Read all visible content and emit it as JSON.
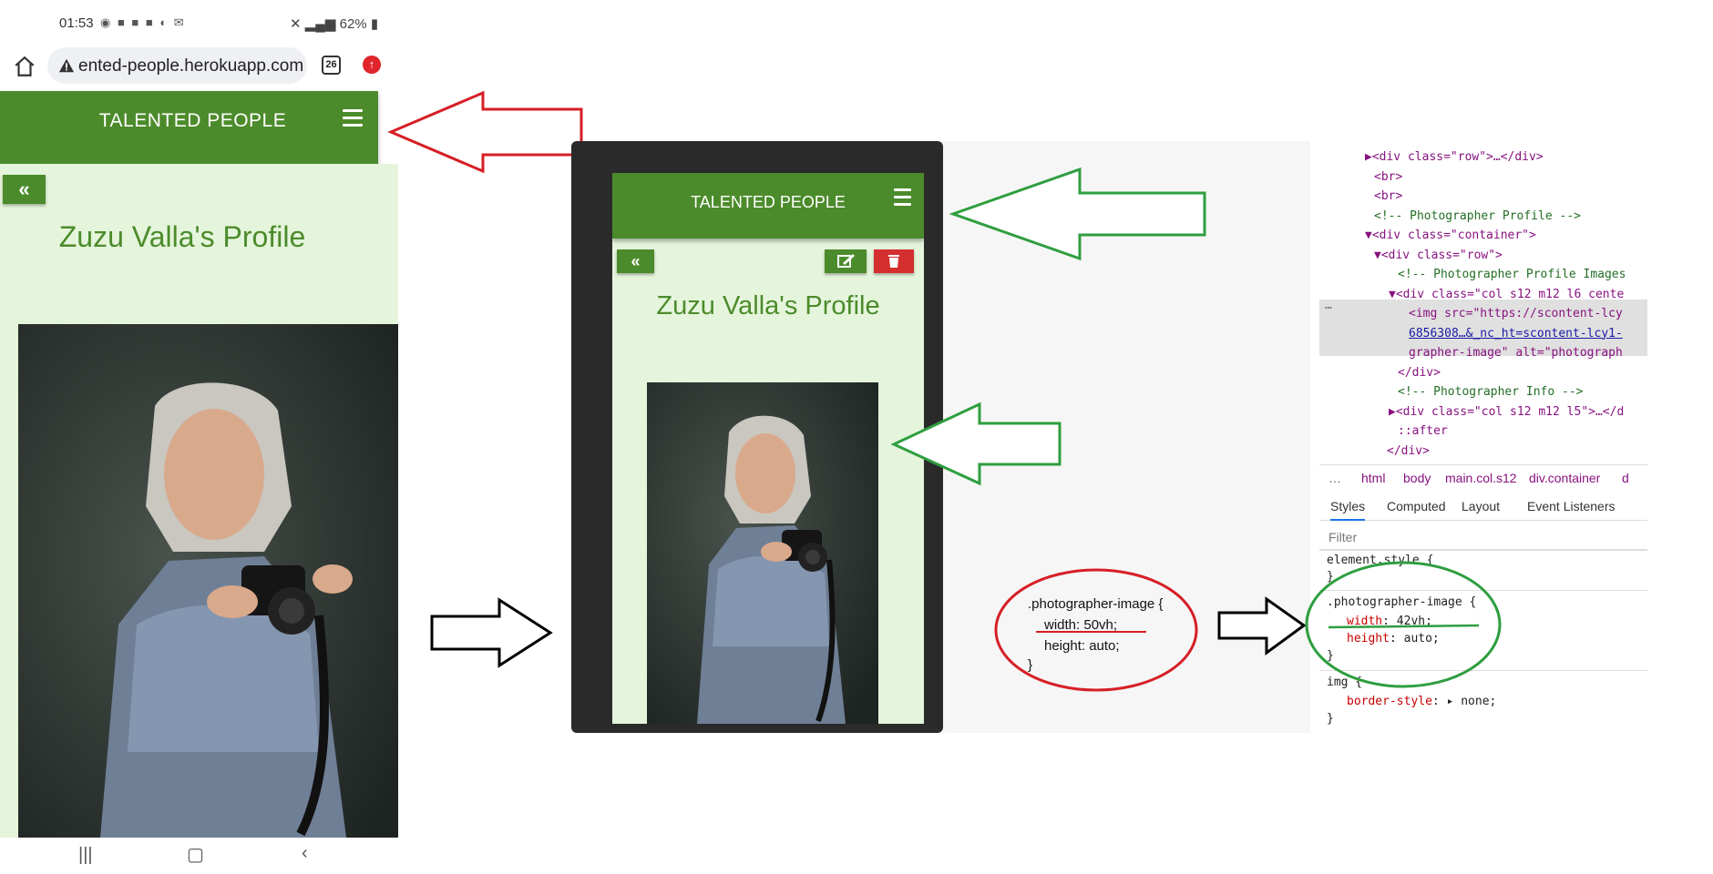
{
  "phone_status": {
    "time": "01:53",
    "battery": "62%"
  },
  "browser": {
    "url": "ented-people.herokuapp.com",
    "tab_count": "26"
  },
  "site": {
    "brand": "TALENTED PEOPLE",
    "back_label": "«",
    "profile_title": "Zuzu Valla's Profile"
  },
  "devtools": {
    "elements": [
      {
        "type": "tag",
        "text": "▶<div class=\"row\">…</div>"
      },
      {
        "type": "tag",
        "text": "<br>"
      },
      {
        "type": "tag",
        "text": "<br>"
      },
      {
        "type": "comment",
        "text": "<!-- Photographer Profile -->"
      },
      {
        "type": "tag",
        "text": "▼<div class=\"container\">"
      },
      {
        "type": "tag",
        "text": "▼<div class=\"row\">"
      },
      {
        "type": "comment",
        "text": "<!-- Photographer Profile Images"
      },
      {
        "type": "tag",
        "text": "▼<div class=\"col s12 m12 l6 cente"
      },
      {
        "type": "img1",
        "text": "<img src=\"https://scontent-lcy"
      },
      {
        "type": "img2",
        "text": "6856308…&_nc_ht=scontent-lcy1-"
      },
      {
        "type": "img3",
        "text": "grapher-image\" alt=\"photograph"
      },
      {
        "type": "tag",
        "text": "</div>"
      },
      {
        "type": "comment",
        "text": "<!-- Photographer Info -->"
      },
      {
        "type": "tag",
        "text": "▶<div class=\"col s12 m12 l5\">…</d"
      },
      {
        "type": "tag",
        "text": "::after"
      },
      {
        "type": "tag",
        "text": "</div>"
      }
    ],
    "breadcrumbs": [
      "…",
      "html",
      "body",
      "main.col.s12",
      "div.container",
      "d"
    ],
    "tabs": [
      "Styles",
      "Computed",
      "Layout",
      "Event Listeners"
    ],
    "filter_placeholder": "Filter",
    "element_style": "element.style {",
    "close_brace": "}",
    "rule_selector": ".photographer-image {",
    "rule_width_prop": "width",
    "rule_width_val": "42vh;",
    "rule_height_prop": "height",
    "rule_height_val": "auto;",
    "img_selector": "img {",
    "img_border_prop": "border-style",
    "img_border_val": "none;"
  },
  "annotation": {
    "selector": ".photographer-image {",
    "width_line": "width: 50vh;",
    "height_line": "height: auto;",
    "close": "}"
  },
  "colors": {
    "brand_green": "#4c8b2b",
    "light_green_bg": "#e5f5dc",
    "delete_red": "#d32f2f",
    "arrow_red": "#d61f26",
    "arrow_green": "#2e9e3f",
    "arrow_black": "#000000"
  }
}
